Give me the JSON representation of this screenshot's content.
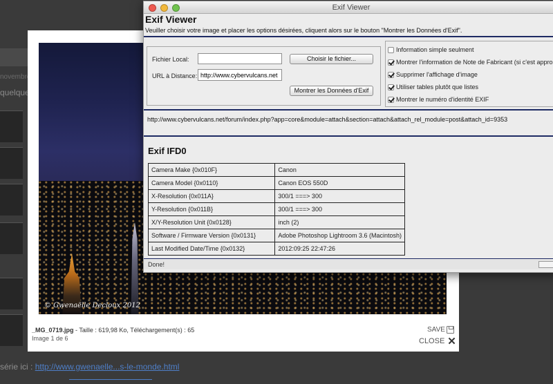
{
  "background": {
    "date_text": "novembre",
    "text": "quelques",
    "series_prefix": "série ici :",
    "series_link": "http://www.gwenaelle...s-le-monde.html"
  },
  "lightbox": {
    "photo_credit": "© Gwenaëlle Decloux 2012",
    "caption_file": "_MG_0719.jpg",
    "caption_rest": " - Taille : 619,98 Ko, Téléchargement(s) : 65",
    "image_count": "Image 1 de 6",
    "save_label": "SAVE",
    "close_label": "CLOSE"
  },
  "exif_window": {
    "title": "Exif Viewer",
    "app_title": "Exif Viewer",
    "subtitle": "Veuiller choisir votre image et placer les options désirées, cliquent alors sur le bouton \"Montrer les Données d'Exif\".",
    "form": {
      "local_label": "Fichier Local:",
      "local_value": "",
      "choose_button": "Choisir le fichier...",
      "url_label": "URL à Distance:",
      "url_value": "http://www.cybervulcans.net",
      "show_button": "Montrer les Données d'Exif"
    },
    "options": [
      {
        "label": "Information simple seulment",
        "checked": false
      },
      {
        "label": "Montrer l'information de Note de Fabricant (si c'est approp",
        "checked": true
      },
      {
        "label": "Supprimer l'affichage d'image",
        "checked": true
      },
      {
        "label": "Utiliser tables plutôt que listes",
        "checked": true
      },
      {
        "label": "Montrer le numéro d'identité EXIF",
        "checked": true
      }
    ],
    "url_display": "http://www.cybervulcans.net/forum/index.php?app=core&module=attach&section=attach&attach_rel_module=post&attach_id=9353",
    "section_title": "Exif IFD0",
    "table": [
      {
        "key": "Camera Make {0x010F}",
        "value": "Canon"
      },
      {
        "key": "Camera Model {0x0110}",
        "value": "Canon EOS 550D"
      },
      {
        "key": "X-Resolution {0x011A}",
        "value": "300/1 ===> 300"
      },
      {
        "key": "Y-Resolution {0x011B}",
        "value": "300/1 ===> 300"
      },
      {
        "key": "X/Y-Resolution Unit {0x0128}",
        "value": "inch (2)"
      },
      {
        "key": "Software / Firmware Version {0x0131}",
        "value": "Adobe Photoshop Lightroom 3.6 (Macintosh)"
      },
      {
        "key": "Last Modified Date/Time {0x0132}",
        "value": "2012:09:25 22:47:26"
      }
    ],
    "status": "Done!"
  }
}
